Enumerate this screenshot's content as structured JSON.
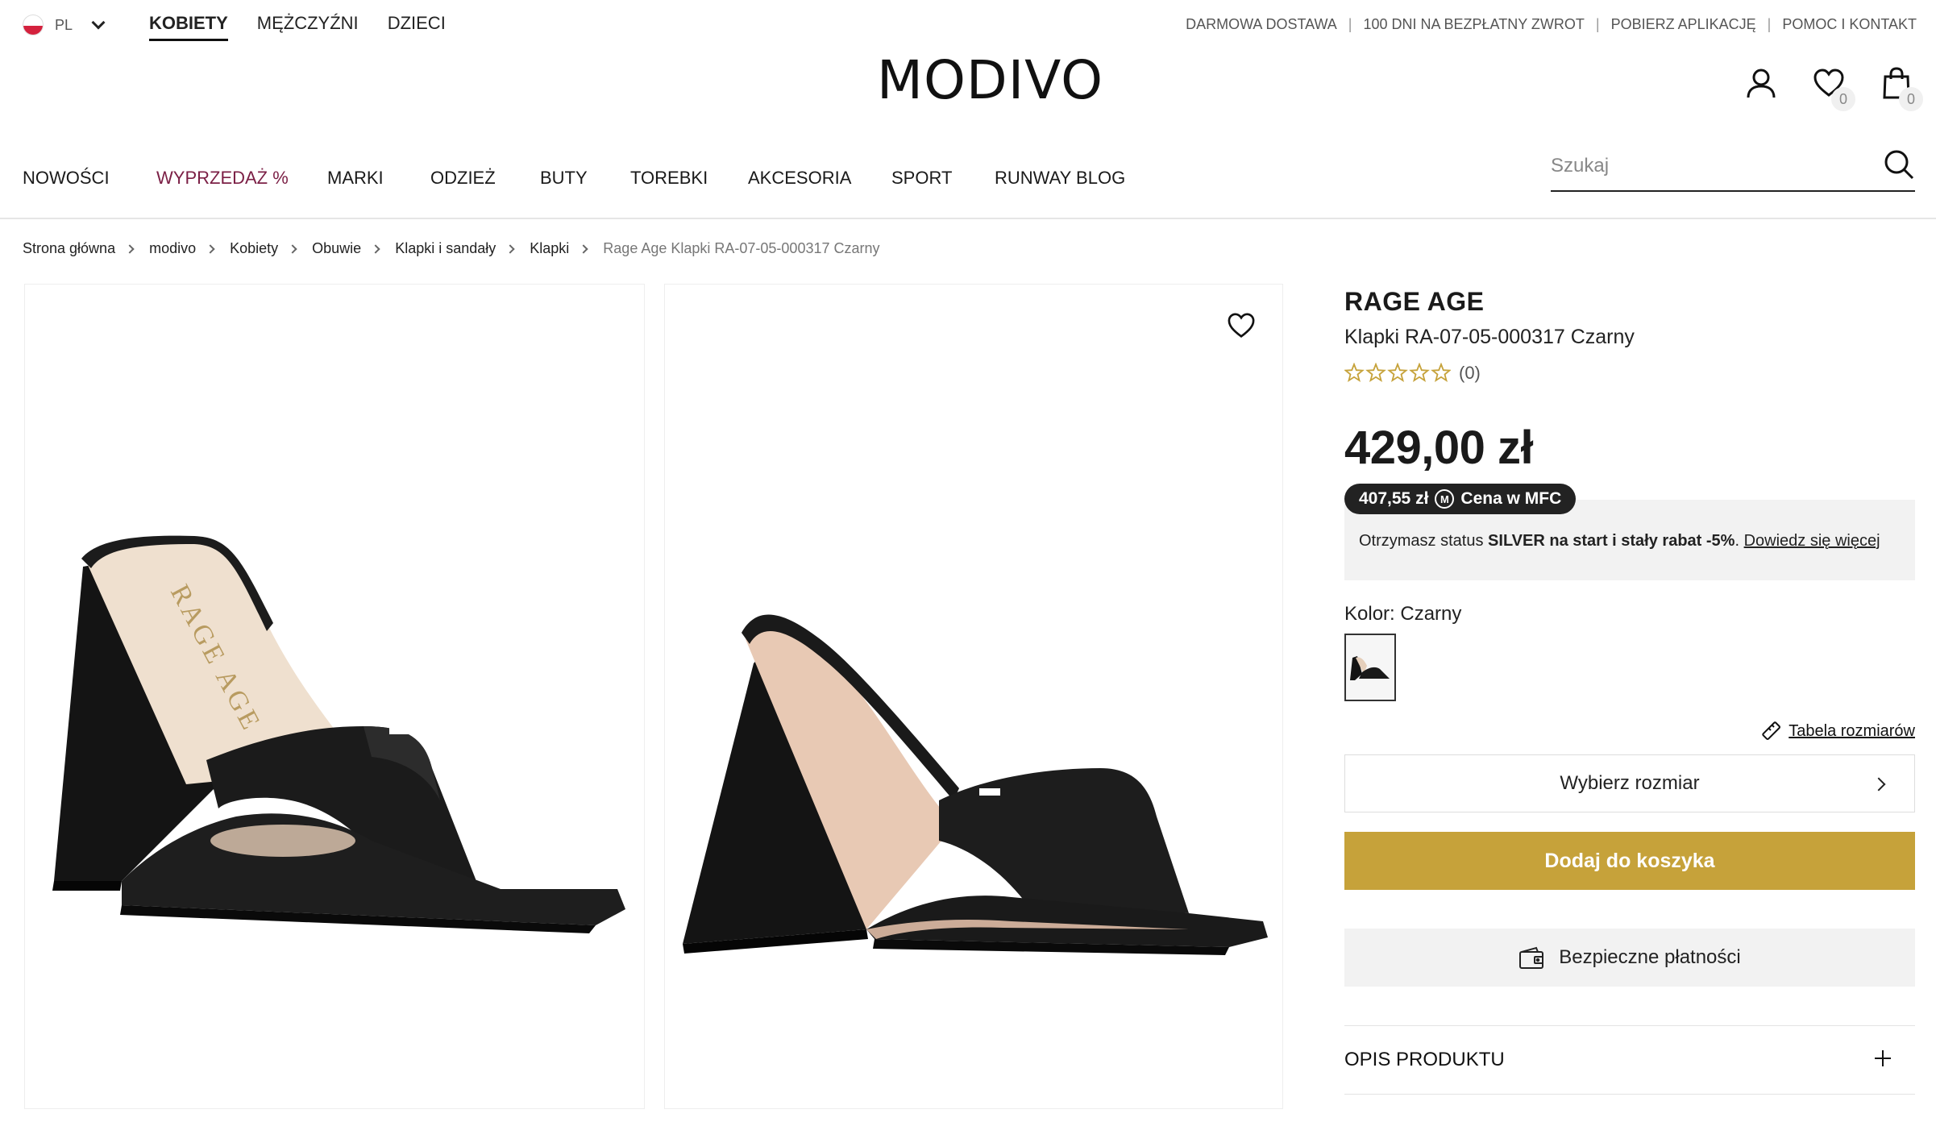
{
  "top": {
    "lang": "PL",
    "gender_tabs": [
      "KOBIETY",
      "MĘŻCZYŹNI",
      "DZIECI"
    ],
    "active_gender": "KOBIETY",
    "links": [
      "DARMOWA DOSTAWA",
      "100 DNI NA BEZPŁATNY ZWROT",
      "POBIERZ APLIKACJĘ",
      "POMOC I KONTAKT"
    ],
    "separator": "|"
  },
  "logo": "MODIVO",
  "user": {
    "wishlist_count": "0",
    "cart_count": "0"
  },
  "nav": {
    "items": [
      "NOWOŚCI",
      "WYPRZEDAŻ %",
      "MARKI",
      "ODZIEŻ",
      "BUTY",
      "TOREBKI",
      "AKCESORIA",
      "SPORT",
      "RUNWAY BLOG"
    ],
    "sale_color": "#7b1f45"
  },
  "search": {
    "placeholder": "Szukaj"
  },
  "breadcrumb": [
    "Strona główna",
    "modivo",
    "Kobiety",
    "Obuwie",
    "Klapki i sandały",
    "Klapki",
    "Rage Age Klapki RA-07-05-000317 Czarny"
  ],
  "product": {
    "brand": "RAGE AGE",
    "name": "Klapki RA-07-05-000317 Czarny",
    "rating_count": "(0)",
    "rating_value": 0,
    "rating_max": 5,
    "price": "429,00 zł",
    "mfc_price": "407,55 zł",
    "mfc_icon_letter": "M",
    "mfc_label": "Cena w MFC",
    "mfc_info_prefix": "Otrzymasz status",
    "mfc_info_bold": "SILVER na start i stały rabat -5%",
    "mfc_info_dot": ".",
    "mfc_info_link": "Dowiedz się więcej",
    "color_label": "Kolor: Czarny",
    "size_table": "Tabela rozmiarów",
    "size_select": "Wybierz rozmiar",
    "add_to_cart": "Dodaj do koszyka",
    "safe_payments": "Bezpieczne płatności",
    "description_header": "OPIS PRODUKTU",
    "insole_text": "RAGE AGE"
  },
  "colors": {
    "accent": "#c6a23a",
    "star": "#c6a23a",
    "pill": "#222222"
  }
}
